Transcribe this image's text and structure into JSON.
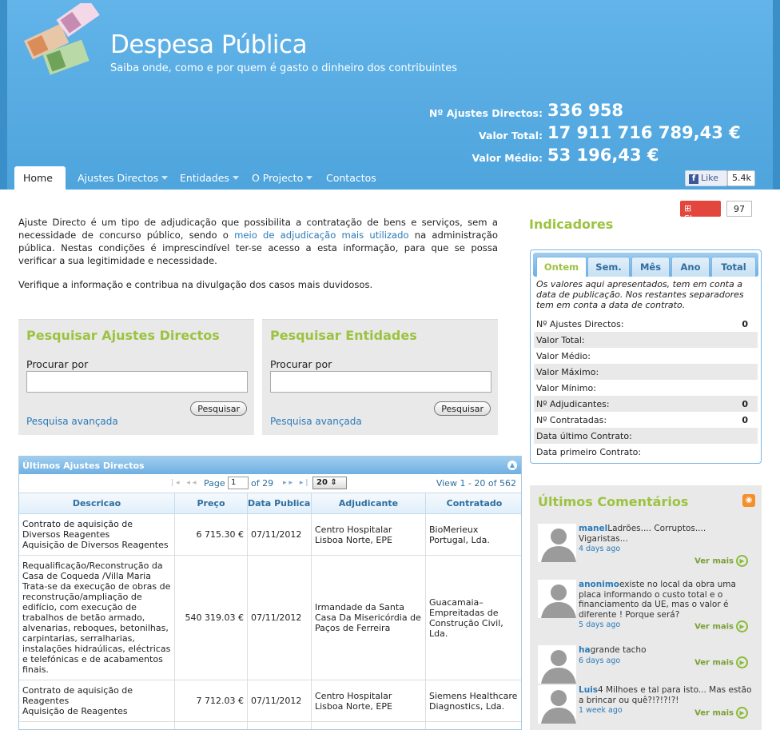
{
  "site": {
    "title": "Despesa Pública",
    "subtitle": "Saiba onde, como e por quem é gasto o dinheiro dos contribuintes"
  },
  "stats": [
    {
      "label": "Nº Ajustes Directos:",
      "value": "336 958"
    },
    {
      "label": "Valor Total:",
      "value": "17 911 716 789,43 €"
    },
    {
      "label": "Valor Médio:",
      "value": "53 196,43 €"
    }
  ],
  "nav": {
    "home": "Home",
    "ajustes": "Ajustes Directos",
    "entidades": "Entidades",
    "projecto": "O Projecto",
    "contactos": "Contactos"
  },
  "facebook": {
    "like": "Like",
    "count": "5.4k"
  },
  "intro": {
    "p1_a": "Ajuste Directo é um tipo de adjudicação que possibilita a contratação de bens e serviços, sem a necessidade de concurso público, sendo o ",
    "p1_link": "meio de adjudicação mais utilizado",
    "p1_b": " na administração pública. Nestas condições é imprescindível ter-se acesso a esta informação, para que se possa verificar a sua legitimidade e necessidade.",
    "p2": "Verifique a informação e contribua na divulgação dos casos mais duvidosos."
  },
  "search_ajustes": {
    "title": "Pesquisar Ajustes Directos",
    "label": "Procurar por",
    "value": "",
    "button": "Pesquisar",
    "advanced": "Pesquisa avançada"
  },
  "search_entidades": {
    "title": "Pesquisar Entidades",
    "label": "Procurar por",
    "value": "",
    "button": "Pesquisar",
    "advanced": "Pesquisa avançada"
  },
  "grid": {
    "title": "Últimos Ajustes Directos",
    "page_label": "Page",
    "page_value": "1",
    "of_label": "of 29",
    "rows": "20",
    "view": "View 1 - 20 of 562",
    "columns": [
      "Descricao",
      "Preço",
      "Data Publicação",
      "Adjudicante",
      "Contratado"
    ],
    "data": [
      {
        "desc": "Contrato de aquisição de Diversos Reagentes\nAquisição de Diversos Reagentes",
        "preco": "6 715.30 €",
        "data": "07/11/2012",
        "adj": "Centro Hospitalar Lisboa Norte, EPE",
        "cont": "BioMerieux Portugal, Lda."
      },
      {
        "desc": "Requalificação/Reconstrução da Casa de Coqueda /Villa Maria Trata-se da execução de obras de reconstrução/ampliação de edifício, com execução de trabalhos de betão armado, alvenarias, reboques, betonilhas, carpintarias, serralharias, instalações hidraúlicas, eléctricas e telefónicas e de acabamentos finais.",
        "preco": "540 319.03 €",
        "data": "07/11/2012",
        "adj": "Irmandade da Santa Casa Da Misericórdia de Paços de Ferreira",
        "cont": "Guacamaia–Empreitadas de Construção Civil, Lda."
      },
      {
        "desc": "Contrato de aquisição de Reagentes\nAquisição de Reagentes",
        "preco": "7 712.03 €",
        "data": "07/11/2012",
        "adj": "Centro Hospitalar Lisboa Norte, EPE",
        "cont": "Siemens Healthcare Diagnostics, Lda."
      }
    ]
  },
  "indicadores": {
    "title": "Indicadores",
    "share": "Share",
    "share_count": "97",
    "tabs": [
      "Ontem",
      "Sem.",
      "Mês",
      "Ano",
      "Total"
    ],
    "note": "Os valores aqui apresentados, tem em conta a data de publicação. Nos restantes separadores tem em conta a data de contrato.",
    "rows": [
      {
        "label": "Nº Ajustes Directos:",
        "value": "0"
      },
      {
        "label": "Valor Total:",
        "value": ""
      },
      {
        "label": "Valor Médio:",
        "value": ""
      },
      {
        "label": "Valor Máximo:",
        "value": ""
      },
      {
        "label": "Valor Mínimo:",
        "value": ""
      },
      {
        "label": "Nº Adjudicantes:",
        "value": "0"
      },
      {
        "label": "Nº Contratadas:",
        "value": "0"
      },
      {
        "label": "Data último Contrato:",
        "value": ""
      },
      {
        "label": "Data primeiro Contrato:",
        "value": ""
      }
    ]
  },
  "comentarios": {
    "title": "Últimos Comentários",
    "more": "Ver mais",
    "items": [
      {
        "user": "manel",
        "text": "Ladrões.... Corruptos.... Vigaristas...",
        "ago": "4 days ago"
      },
      {
        "user": "anonimo",
        "text": "existe no local da obra uma placa informando o custo total e o financiamento da UE, mas o valor é diferente ! Porque será?",
        "ago": "5 days ago"
      },
      {
        "user": "ha",
        "text": "grande tacho",
        "ago": "6 days ago"
      },
      {
        "user": "Luis",
        "text": "4 Milhoes e tal para isto... Mas estão a brincar ou quê?!?!?!?!",
        "ago": "1 week ago"
      }
    ]
  }
}
